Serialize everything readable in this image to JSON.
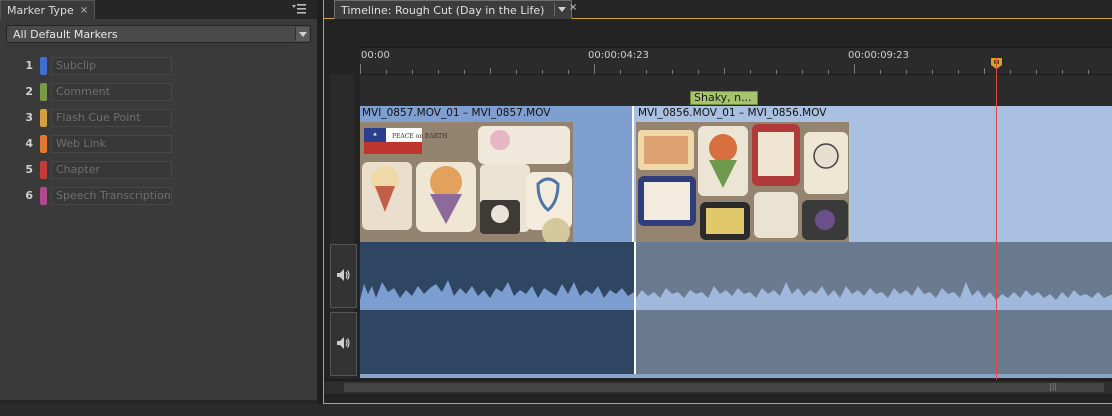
{
  "marker_panel": {
    "tab_title": "Marker Type",
    "tab_close": "×",
    "dropdown_value": "All Default Markers",
    "markers": [
      {
        "num": "1",
        "label": "Subclip",
        "color": "#3f6fd0"
      },
      {
        "num": "2",
        "label": "Comment",
        "color": "#7a9a48"
      },
      {
        "num": "3",
        "label": "Flash Cue Point",
        "color": "#d2a03c"
      },
      {
        "num": "4",
        "label": "Web Link",
        "color": "#e2772e"
      },
      {
        "num": "5",
        "label": "Chapter",
        "color": "#c83b3b"
      },
      {
        "num": "6",
        "label": "Speech Transcription",
        "color": "#b04a8e"
      }
    ]
  },
  "timeline": {
    "tab_title": "Timeline: Rough Cut (Day in the Life)",
    "tab_close": "×",
    "ruler_labels": [
      "00:00",
      "00:00:04:23",
      "00:00:09:23"
    ],
    "clip_marker_label": "Shaky, n...",
    "clips": [
      {
        "name": "MVI_0857.MOV_01 – MVI_0857.MOV"
      },
      {
        "name": "MVI_0856.MOV_01 – MVI_0856.MOV"
      }
    ],
    "colors": {
      "video_selected": "#7f9fd0",
      "video_unselected": "#a9c0e0",
      "audio_selected": "#2f4663",
      "audio_unselected": "#6b7b8f",
      "playhead": "#e04848",
      "marker": "#a6c46c"
    }
  },
  "icons": {
    "panel_menu": "panel-menu-icon",
    "dropdown": "chevron-down-icon",
    "speaker": "speaker-icon"
  }
}
